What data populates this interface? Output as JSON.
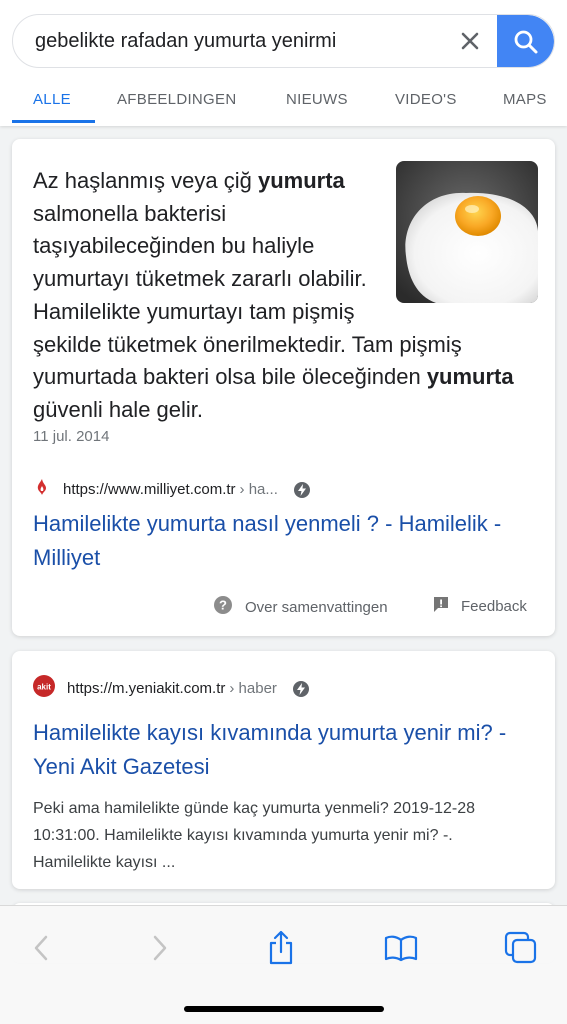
{
  "search": {
    "query": "gebelikte rafadan yumurta yenirmi"
  },
  "tabs": [
    {
      "label": "ALLE",
      "active": true
    },
    {
      "label": "AFBEELDINGEN",
      "active": false
    },
    {
      "label": "NIEUWS",
      "active": false
    },
    {
      "label": "VIDEO'S",
      "active": false
    },
    {
      "label": "MAPS",
      "active": false
    }
  ],
  "featured": {
    "snippet_parts": [
      "Az haşlanmış veya çiğ ",
      "yumurta",
      " salmonella bakterisi taşıyabileceğinden bu haliyle yumurtayı tüketmek zararlı olabilir. Hamilelikte yumurtayı tam pişmiş şekilde tüketmek önerilmektedir. Tam pişmiş yumurtada bakteri olsa bile öleceğinden ",
      "yumurta",
      " güvenli hale gelir."
    ],
    "date": "11 jul. 2014",
    "image": "fried-egg-image",
    "source_url": "https://www.milliyet.com.tr",
    "source_crumb": "› ha...",
    "title": "Hamilelikte yumurta nasıl yenmeli ? - Hamilelik - Milliyet",
    "about_label": "Over samenvattingen",
    "feedback_label": "Feedback"
  },
  "result2": {
    "favicon_text": "akit",
    "source_url": "https://m.yeniakit.com.tr",
    "source_crumb": "› haber",
    "title": "Hamilelikte kayısı kıvamında yumurta yenir mi? - Yeni Akit Gazetesi",
    "description": "Peki ama hamilelikte günde kaç yumurta yenmeli? 2019-12-28 10:31:00. Hamilelikte kayısı kıvamında yumurta yenir mi? -. Hamilelikte kayısı ..."
  },
  "icons": {
    "clear": "close-icon",
    "search": "search-icon",
    "amp": "amp-lightning-icon",
    "help": "help-circle-icon",
    "feedback": "feedback-icon",
    "back": "back-chevron-icon",
    "forward": "forward-chevron-icon",
    "share": "share-icon",
    "bookmarks": "book-icon",
    "tabs": "tabs-icon"
  },
  "colors": {
    "accent": "#1a73e8",
    "search_button": "#4285f4",
    "link": "#1a4fa8",
    "milliyet_red": "#d32f2f",
    "akit_red": "#c62828"
  }
}
